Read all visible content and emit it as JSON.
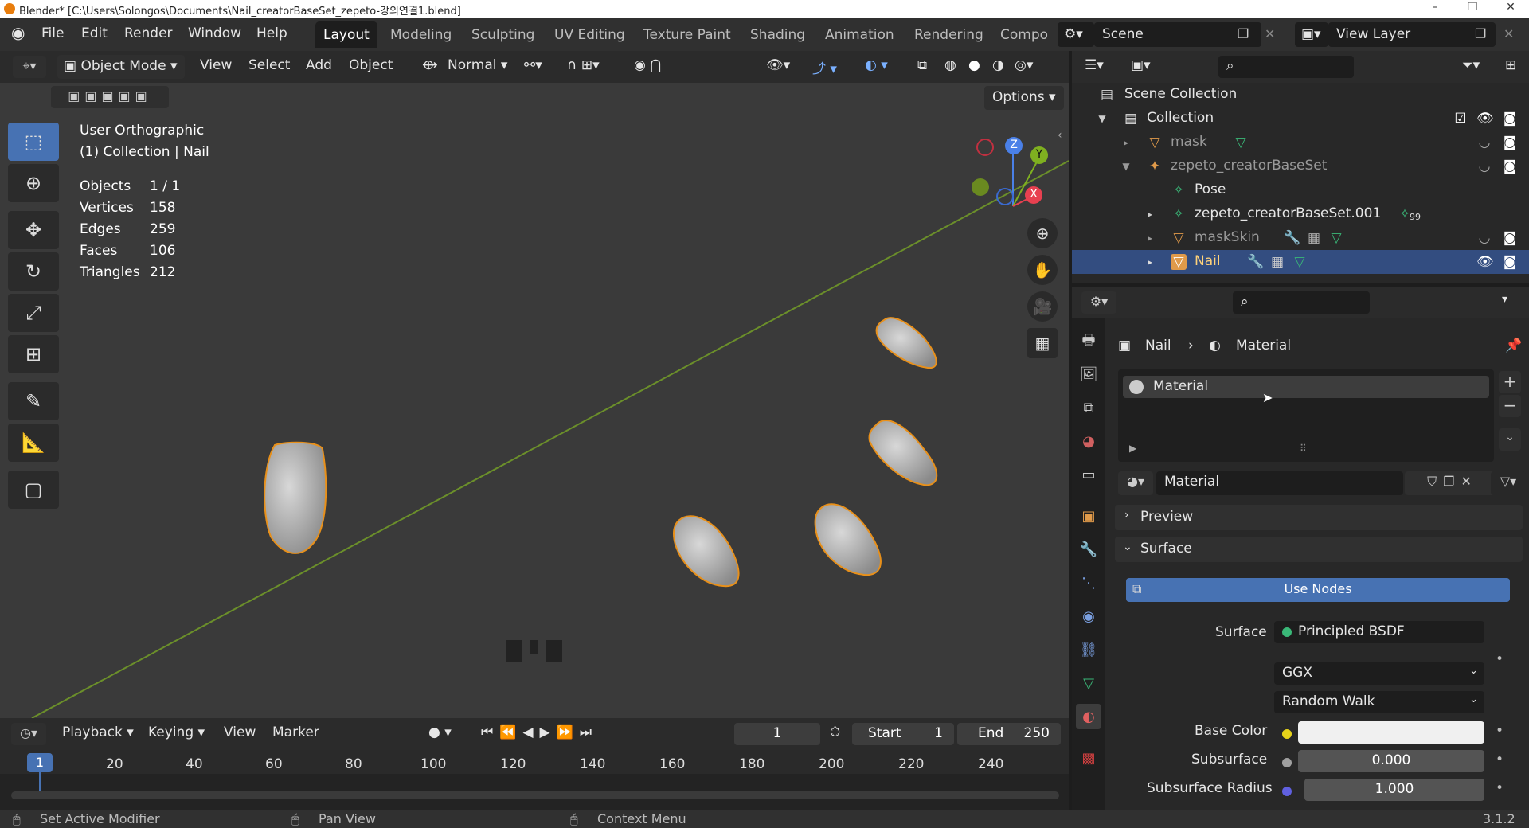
{
  "window": {
    "title": "Blender* [C:\\Users\\Solongos\\Documents\\Nail_creatorBaseSet_zepeto-강의연결1.blend]",
    "minimize": "–",
    "maximize": "❐",
    "close": "✕"
  },
  "menu": [
    "File",
    "Edit",
    "Render",
    "Window",
    "Help"
  ],
  "workspaces": [
    "Layout",
    "Modeling",
    "Sculpting",
    "UV Editing",
    "Texture Paint",
    "Shading",
    "Animation",
    "Rendering",
    "Compo"
  ],
  "scene": {
    "label": "Scene",
    "view_layer": "View Layer"
  },
  "viewport": {
    "mode": "Object Mode",
    "menus": [
      "View",
      "Select",
      "Add",
      "Object"
    ],
    "orientation": "Normal",
    "options": "Options",
    "view_name": "User Orthographic",
    "collection_info": "(1) Collection | Nail",
    "stats": [
      {
        "label": "Objects",
        "value": "1 / 1"
      },
      {
        "label": "Vertices",
        "value": "158"
      },
      {
        "label": "Edges",
        "value": "259"
      },
      {
        "label": "Faces",
        "value": "106"
      },
      {
        "label": "Triangles",
        "value": "212"
      }
    ],
    "gizmo_axes": [
      "Z",
      "Y",
      "X"
    ]
  },
  "timeline": {
    "menus": [
      "Playback",
      "Keying",
      "View",
      "Marker"
    ],
    "current_frame": "1",
    "start_label": "Start",
    "start_value": "1",
    "end_label": "End",
    "end_value": "250",
    "ruler": [
      "1",
      "20",
      "40",
      "60",
      "80",
      "100",
      "120",
      "140",
      "160",
      "180",
      "200",
      "220",
      "240"
    ]
  },
  "status": {
    "left": "Set Active Modifier",
    "middle": "Pan View",
    "right": "Context Menu",
    "version": "3.1.2"
  },
  "outliner": {
    "root": "Scene Collection",
    "collection": "Collection",
    "items": [
      {
        "name": "mask",
        "badge": ""
      },
      {
        "name": "zepeto_creatorBaseSet",
        "badge": ""
      },
      {
        "name": "Pose",
        "badge": ""
      },
      {
        "name": "zepeto_creatorBaseSet.001",
        "badge": "99"
      },
      {
        "name": "maskSkin",
        "badge": ""
      },
      {
        "name": "Nail",
        "badge": ""
      }
    ]
  },
  "properties": {
    "breadcrumb_object": "Nail",
    "breadcrumb_sep": "›",
    "breadcrumb_tab": "Material",
    "slot_name": "Material",
    "material_name": "Material",
    "panels": {
      "preview": "Preview",
      "surface": "Surface"
    },
    "use_nodes": "Use Nodes",
    "surface_label": "Surface",
    "surface_shader": "Principled BSDF",
    "distribution": "GGX",
    "subsurface_method": "Random Walk",
    "base_color_label": "Base Color",
    "subsurface_label": "Subsurface",
    "subsurface_value": "0.000",
    "subsurface_radius_label": "Subsurface Radius",
    "subsurface_radius_value": "1.000"
  },
  "colors": {
    "accent": "#4772b3",
    "selection_outline": "#e8901a",
    "grid_line": "#6b8f2a"
  }
}
